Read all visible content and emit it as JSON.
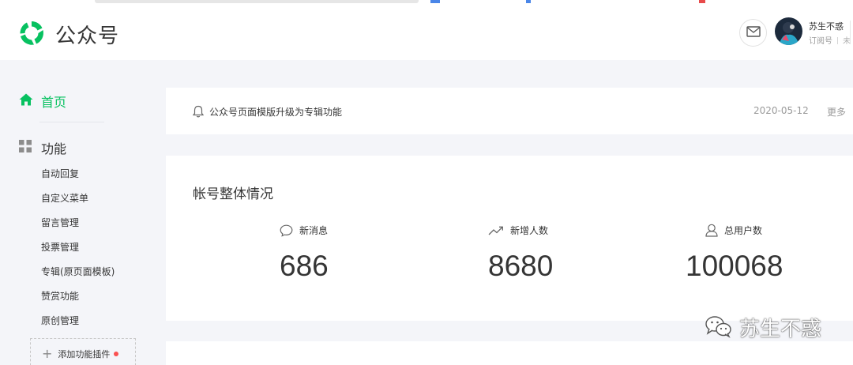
{
  "header": {
    "brand": "公众号",
    "username": "苏生不惑",
    "account_type": "订阅号",
    "account_more": "未",
    "icons": [
      "wechat-logo",
      "mail-icon",
      "avatar"
    ]
  },
  "sidebar": {
    "home_label": "首页",
    "func_label": "功能",
    "items": [
      {
        "label": "自动回复"
      },
      {
        "label": "自定义菜单"
      },
      {
        "label": "留言管理"
      },
      {
        "label": "投票管理"
      },
      {
        "label": "专辑(原页面模板)"
      },
      {
        "label": "赞赏功能"
      },
      {
        "label": "原创管理"
      }
    ],
    "add_plugin_label": "添加功能插件",
    "colors": {
      "active": "#07c160",
      "badge": "#fa5151"
    }
  },
  "notice": {
    "text": "公众号页面模版升级为专辑功能",
    "date": "2020-05-12",
    "more": "更多"
  },
  "stats": {
    "title": "帐号整体情况",
    "items": [
      {
        "label": "新消息",
        "value": "686",
        "icon": "message-icon"
      },
      {
        "label": "新增人数",
        "value": "8680",
        "icon": "trend-icon"
      },
      {
        "label": "总用户数",
        "value": "100068",
        "icon": "user-icon"
      }
    ]
  },
  "watermark": {
    "text": "苏生不惑"
  }
}
